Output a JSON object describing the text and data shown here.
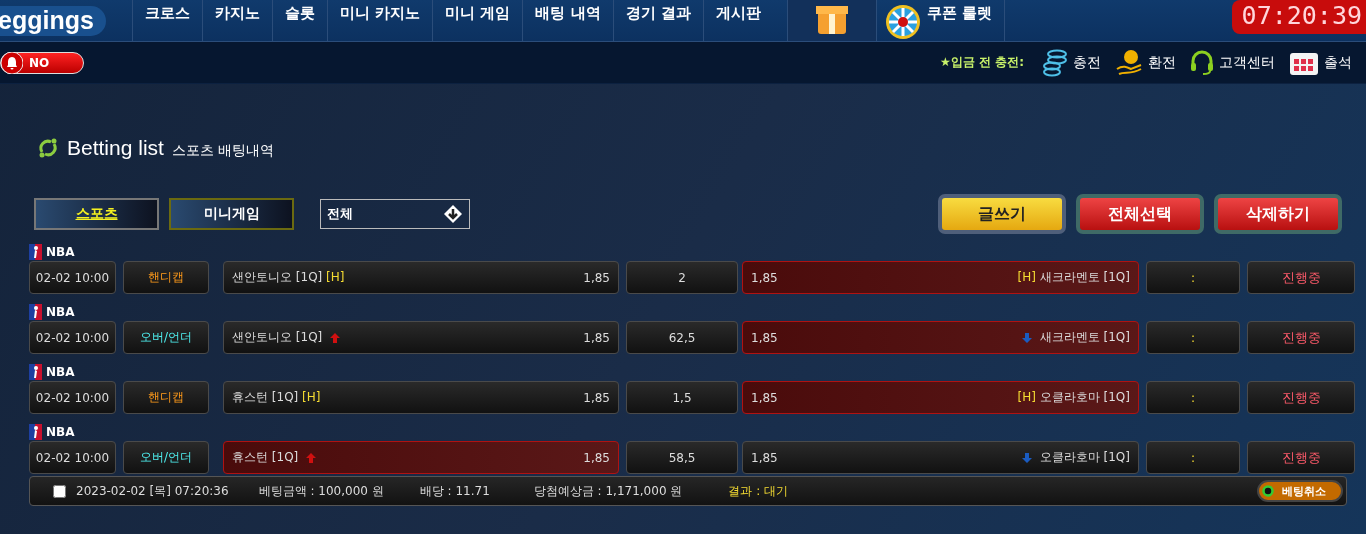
{
  "header": {
    "logo": "eggings",
    "nav": [
      {
        "label": "크로스"
      },
      {
        "label": "카지노"
      },
      {
        "label": "슬롯"
      },
      {
        "label": "미니 카지노"
      },
      {
        "label": "미니 게임"
      },
      {
        "label": "배팅 내역"
      },
      {
        "label": "경기 결과"
      },
      {
        "label": "게시판"
      }
    ],
    "roulette": "쿠폰 룰렛",
    "clock": "07:20:39"
  },
  "subbar": {
    "alarm": {
      "label": "NO",
      "on": false
    },
    "notice": "★입금 전 충전:",
    "links": [
      {
        "kind": "deposit",
        "label": "충전"
      },
      {
        "kind": "withdraw",
        "label": "환전"
      },
      {
        "kind": "support",
        "label": "고객센터"
      },
      {
        "kind": "attendance",
        "label": "출석"
      }
    ]
  },
  "page": {
    "title": "Betting list",
    "subtitle": "스포츠 배팅내역"
  },
  "filters": [
    {
      "label": "스포츠",
      "selected": true
    },
    {
      "label": "미니게임",
      "selected": false
    }
  ],
  "select": {
    "value": "전체"
  },
  "actions": [
    {
      "kind": "write",
      "label": "글쓰기"
    },
    {
      "kind": "select_all",
      "label": "전체선택"
    },
    {
      "kind": "delete",
      "label": "삭제하기"
    }
  ],
  "bets": [
    {
      "league": "NBA",
      "time": "02-02 10:00",
      "type": {
        "kind": "handicap",
        "label": "핸디캡"
      },
      "home": {
        "name": "샌안토니오 [1Q]",
        "tag": "[H]",
        "rising": false,
        "odds": "1,85",
        "selected": false
      },
      "line": "2",
      "away": {
        "name": "새크라멘토 [1Q]",
        "tag": "[H]",
        "falling": false,
        "odds": "1,85",
        "selected": true
      },
      "score": ":",
      "status": "진행중"
    },
    {
      "league": "NBA",
      "time": "02-02 10:00",
      "type": {
        "kind": "over_under",
        "label": "오버/언더"
      },
      "home": {
        "name": "샌안토니오 [1Q]",
        "rising": true,
        "odds": "1,85",
        "selected": false
      },
      "line": "62,5",
      "away": {
        "name": "새크라멘토 [1Q]",
        "falling": true,
        "odds": "1,85",
        "selected": true
      },
      "score": ":",
      "status": "진행중"
    },
    {
      "league": "NBA",
      "time": "02-02 10:00",
      "type": {
        "kind": "handicap",
        "label": "핸디캡"
      },
      "home": {
        "name": "휴스턴 [1Q]",
        "tag": "[H]",
        "rising": false,
        "odds": "1,85",
        "selected": false
      },
      "line": "1,5",
      "away": {
        "name": "오클라호마 [1Q]",
        "tag": "[H]",
        "falling": false,
        "odds": "1,85",
        "selected": true
      },
      "score": ":",
      "status": "진행중"
    },
    {
      "league": "NBA",
      "time": "02-02 10:00",
      "type": {
        "kind": "over_under",
        "label": "오버/언더"
      },
      "home": {
        "name": "휴스턴 [1Q]",
        "rising": true,
        "odds": "1,85",
        "selected": true
      },
      "line": "58,5",
      "away": {
        "name": "오클라호마 [1Q]",
        "falling": true,
        "odds": "1,85",
        "selected": false
      },
      "score": ":",
      "status": "진행중"
    }
  ],
  "summary": {
    "checked": false,
    "date": "2023-02-02 [목] 07:20:36",
    "amount": "베팅금액 : 100,000 원",
    "rate": "배당 : 11.71",
    "payout": "당첨예상금 : 1,171,000 원",
    "result": "결과 : 대기",
    "cancel": "베팅취소"
  }
}
